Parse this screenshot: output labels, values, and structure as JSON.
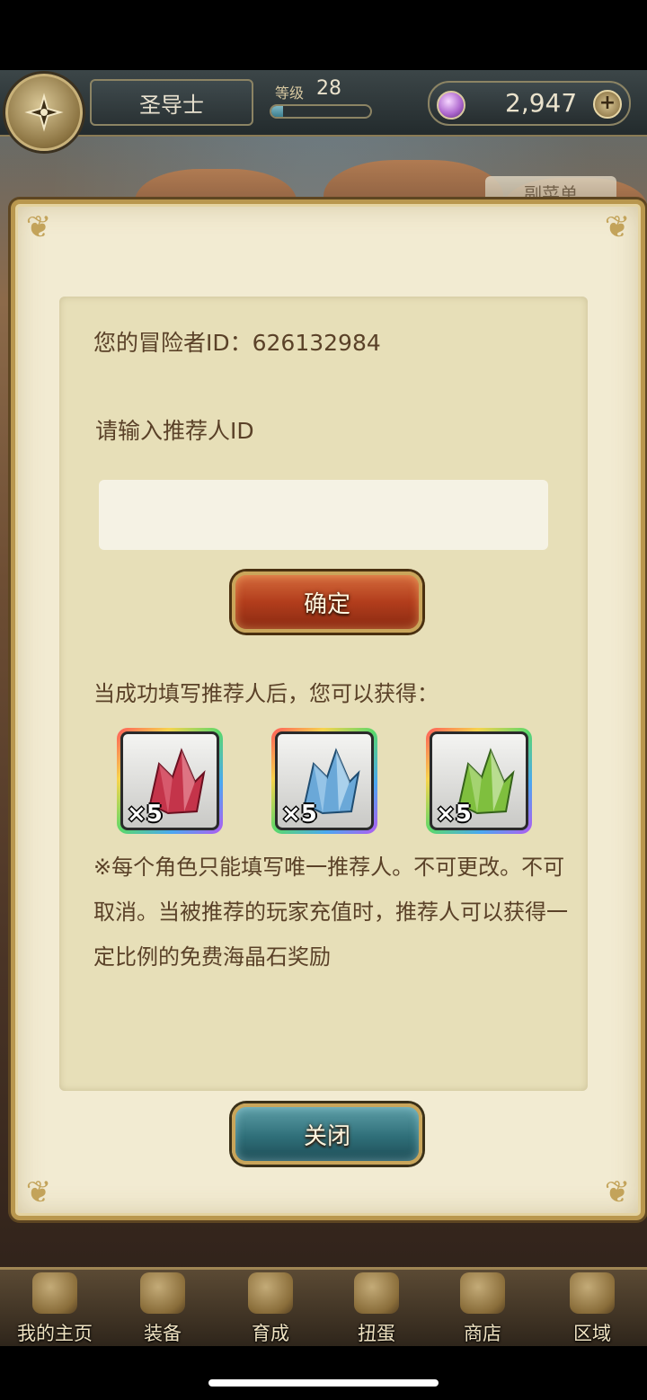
{
  "header": {
    "player_name": "圣导士",
    "level_label": "等级",
    "level_value": "28",
    "level_progress": 0.12,
    "currency_value": "2,947",
    "sub_menu_label": "副菜单"
  },
  "dialog": {
    "adventurer_id_text": "您的冒险者ID：626132984",
    "input_label": "请输入推荐人ID",
    "input_value": "",
    "confirm_label": "确定",
    "reward_title": "当成功填写推荐人后，您可以获得：",
    "rewards": [
      {
        "icon": "red-crystal-icon",
        "color": "#c4344a",
        "quantity": "×5"
      },
      {
        "icon": "blue-crystal-icon",
        "color": "#6aa8d8",
        "quantity": "×5"
      },
      {
        "icon": "green-crystal-icon",
        "color": "#7fbf3e",
        "quantity": "×5"
      }
    ],
    "notice": "※每个角色只能填写唯一推荐人。不可更改。不可取消。当被推荐的玩家充值时，推荐人可以获得一定比例的免费海晶石奖励",
    "close_label": "关闭"
  },
  "bottom_nav": {
    "items": [
      {
        "label": "我的主页",
        "icon": "scroll-icon"
      },
      {
        "label": "装备",
        "icon": "helmet-icon"
      },
      {
        "label": "育成",
        "icon": "sword-icon"
      },
      {
        "label": "扭蛋",
        "icon": "gacha-icon"
      },
      {
        "label": "商店",
        "icon": "shop-icon"
      },
      {
        "label": "区域",
        "icon": "globe-icon"
      }
    ]
  },
  "colors": {
    "dialog_bg": "#f2ebd2",
    "panel_bg": "#e7dfb8",
    "text": "#5a4128",
    "confirm_button": "#b23d1c",
    "close_button": "#2f6f79"
  }
}
